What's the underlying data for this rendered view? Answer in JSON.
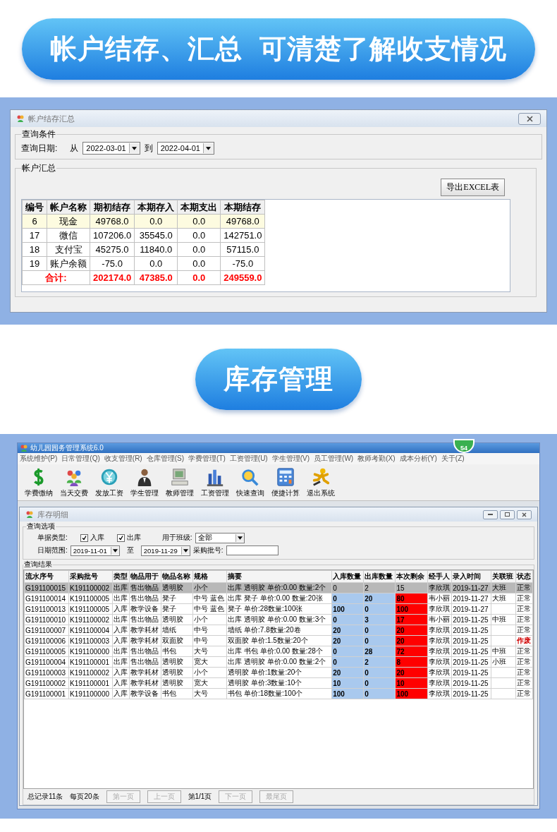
{
  "banner_1": {
    "title": "帐户结存、汇总  可清楚了解收支情况"
  },
  "account_window": {
    "title": "帐户结存汇总",
    "query_group": {
      "label": "查询条件",
      "date_label": "查询日期:",
      "from_label": "从",
      "from": "2022-03-01",
      "to_label": "到",
      "to": "2022-04-01"
    },
    "summary_group": {
      "label": "帐户汇总",
      "export_button": "导出EXCEL表",
      "columns": [
        "编号",
        "帐户名称",
        "期初结存",
        "本期存入",
        "本期支出",
        "本期结存"
      ],
      "rows": [
        {
          "cells": [
            "6",
            "现金",
            "49768.0",
            "0.0",
            "0.0",
            "49768.0"
          ],
          "selected": true
        },
        {
          "cells": [
            "17",
            "微信",
            "107206.0",
            "35545.0",
            "0.0",
            "142751.0"
          ],
          "selected": false
        },
        {
          "cells": [
            "18",
            "支付宝",
            "45275.0",
            "11840.0",
            "0.0",
            "57115.0"
          ],
          "selected": false
        },
        {
          "cells": [
            "19",
            "账户余额",
            "-75.0",
            "0.0",
            "0.0",
            "-75.0"
          ],
          "selected": false
        }
      ],
      "total": {
        "label": "合计:",
        "values": [
          "202174.0",
          "47385.0",
          "0.0",
          "249559.0"
        ]
      }
    }
  },
  "banner_2": {
    "title": "库存管理"
  },
  "app_window": {
    "title": "幼儿园园务管理系统6.0",
    "badge": "54",
    "menu": [
      "系统维护(P)",
      "日常管理(Q)",
      "收支管理(R)",
      "仓库管理(S)",
      "学费管理(T)",
      "工资管理(U)",
      "学生管理(V)",
      "员工管理(W)",
      "教师考勤(X)",
      "成本分析(Y)",
      "关于(Z)"
    ],
    "toolbar": [
      "学费缴纳",
      "当天交费",
      "发放工资",
      "学生管理",
      "教师管理",
      "工资管理",
      "快速查询",
      "便捷计算",
      "退出系统"
    ]
  },
  "inventory_window": {
    "title": "库存明细",
    "query_group": {
      "label": "查询选项",
      "type_label": "单据类型:",
      "checkboxes": [
        {
          "label": "入库",
          "checked": true
        },
        {
          "label": "出库",
          "checked": true
        }
      ],
      "class_label": "用于班级:",
      "class_value": "全部",
      "date_label": "日期范围:",
      "from": "2019-11-01",
      "to_label": "至",
      "to": "2019-11-29",
      "batch_label": "采购批号:"
    },
    "result_group": {
      "label": "查询结果",
      "columns": [
        {
          "label": "流水序号"
        },
        {
          "label": "采购批号"
        },
        {
          "label": "类型"
        },
        {
          "label": "物品用于"
        },
        {
          "label": "物品名称"
        },
        {
          "label": "规格"
        },
        {
          "label": "摘要"
        },
        {
          "label": "入库数量",
          "color": "#a9c9ee"
        },
        {
          "label": "出库数量",
          "color": "#a9c9ee"
        },
        {
          "label": "本次剩余",
          "color": "#ff0000"
        },
        {
          "label": "经手人"
        },
        {
          "label": "录入时间"
        },
        {
          "label": "关联班"
        },
        {
          "label": "状态"
        }
      ],
      "rows": [
        {
          "cells": [
            "G191100015",
            "K191100002",
            "出库",
            "售出物品",
            "透明胶",
            "小个",
            "出库 透明胶 单价:0.00 数量:2个",
            "0",
            "2",
            "15",
            "李欣琪",
            "2019-11-27",
            "大班",
            "正常"
          ],
          "selected": true,
          "voided": false
        },
        {
          "cells": [
            "G191100014",
            "K191100005",
            "出库",
            "售出物品",
            "凳子",
            "中号 蓝色",
            "出库 凳子 单价:0.00 数量:20张",
            "0",
            "20",
            "80",
            "韦小丽",
            "2019-11-27",
            "大班",
            "正常"
          ],
          "selected": false,
          "voided": false
        },
        {
          "cells": [
            "G191100013",
            "K191100005",
            "入库",
            "教学设备",
            "凳子",
            "中号 蓝色",
            "凳子 单价:28数量:100张",
            "100",
            "0",
            "100",
            "李欣琪",
            "2019-11-27",
            "",
            "正常"
          ],
          "selected": false,
          "voided": false
        },
        {
          "cells": [
            "G191100010",
            "K191100002",
            "出库",
            "售出物品",
            "透明胶",
            "小个",
            "出库 透明胶 单价:0.00 数量:3个",
            "0",
            "3",
            "17",
            "韦小丽",
            "2019-11-25",
            "中班",
            "正常"
          ],
          "selected": false,
          "voided": false
        },
        {
          "cells": [
            "G191100007",
            "K191100004",
            "入库",
            "教学耗材",
            "墙纸",
            "中号",
            "墙纸 单价:7.8数量:20卷",
            "20",
            "0",
            "20",
            "李欣琪",
            "2019-11-25",
            "",
            "正常"
          ],
          "selected": false,
          "voided": false
        },
        {
          "cells": [
            "G191100006",
            "K191100003",
            "入库",
            "教学耗材",
            "双面胶",
            "中号",
            "双面胶 单价:1.5数量:20个",
            "20",
            "0",
            "20",
            "李欣琪",
            "2019-11-25",
            "",
            "作废"
          ],
          "selected": false,
          "voided": true
        },
        {
          "cells": [
            "G191100005",
            "K191100000",
            "出库",
            "售出物品",
            "书包",
            "大号",
            "出库 书包 单价:0.00 数量:28个",
            "0",
            "28",
            "72",
            "李欣琪",
            "2019-11-25",
            "中班",
            "正常"
          ],
          "selected": false,
          "voided": false
        },
        {
          "cells": [
            "G191100004",
            "K191100001",
            "出库",
            "售出物品",
            "透明胶",
            "宽大",
            "出库 透明胶 单价:0.00 数量:2个",
            "0",
            "2",
            "8",
            "李欣琪",
            "2019-11-25",
            "小班",
            "正常"
          ],
          "selected": false,
          "voided": false
        },
        {
          "cells": [
            "G191100003",
            "K191100002",
            "入库",
            "教学耗材",
            "透明胶",
            "小个",
            "透明胶 单价:1数量:20个",
            "20",
            "0",
            "20",
            "李欣琪",
            "2019-11-25",
            "",
            "正常"
          ],
          "selected": false,
          "voided": false
        },
        {
          "cells": [
            "G191100002",
            "K191100001",
            "入库",
            "教学耗材",
            "透明胶",
            "宽大",
            "透明胶 单价:3数量:10个",
            "10",
            "0",
            "10",
            "李欣琪",
            "2019-11-25",
            "",
            "正常"
          ],
          "selected": false,
          "voided": false
        },
        {
          "cells": [
            "G191100001",
            "K191100000",
            "入库",
            "教学设备",
            "书包",
            "大号",
            "书包 单价:18数量:100个",
            "100",
            "0",
            "100",
            "李欣琪",
            "2019-11-25",
            "",
            "正常"
          ],
          "selected": false,
          "voided": false
        }
      ]
    },
    "footer": {
      "total_records": "总记录11条",
      "page_size": "每页20条",
      "buttons": [
        {
          "label": "第一页",
          "disabled": true
        },
        {
          "label": "上一页",
          "disabled": true
        },
        {
          "label": "下一页",
          "disabled": true
        },
        {
          "label": "最尾页",
          "disabled": true
        }
      ],
      "page": "第1/1页"
    }
  }
}
